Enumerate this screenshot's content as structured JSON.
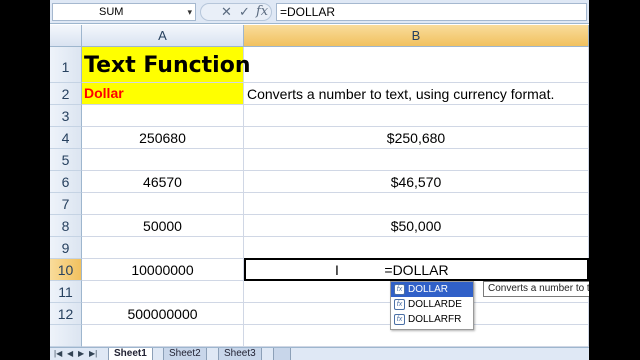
{
  "formula_bar": {
    "name_box": "SUM",
    "name_box_arrow": "▾",
    "cancel": "✕",
    "enter": "✓",
    "fx": "fx",
    "formula": "=DOLLAR"
  },
  "columns": [
    "A",
    "B"
  ],
  "rows": [
    {
      "num": "1",
      "a": "Text Function",
      "b": ""
    },
    {
      "num": "2",
      "a": "Dollar",
      "b": "Converts a number to text, using currency format."
    },
    {
      "num": "3",
      "a": "",
      "b": ""
    },
    {
      "num": "4",
      "a": "250680",
      "b": "$250,680"
    },
    {
      "num": "5",
      "a": "",
      "b": ""
    },
    {
      "num": "6",
      "a": "46570",
      "b": "$46,570"
    },
    {
      "num": "7",
      "a": "",
      "b": ""
    },
    {
      "num": "8",
      "a": "50000",
      "b": "$50,000"
    },
    {
      "num": "9",
      "a": "",
      "b": ""
    },
    {
      "num": "10",
      "a": "10000000",
      "b": "=DOLLAR"
    },
    {
      "num": "11",
      "a": "",
      "b": ""
    },
    {
      "num": "12",
      "a": "500000000",
      "b": ""
    }
  ],
  "autocomplete": {
    "items": [
      "DOLLAR",
      "DOLLARDE",
      "DOLLARFR"
    ],
    "tooltip": "Converts a number to text"
  },
  "sheet_tabs": [
    "Sheet1",
    "Sheet2",
    "Sheet3"
  ],
  "colors": {
    "title_fill": "#ffff00",
    "subtitle_text": "#ff0000",
    "selection": "#3060c8"
  }
}
